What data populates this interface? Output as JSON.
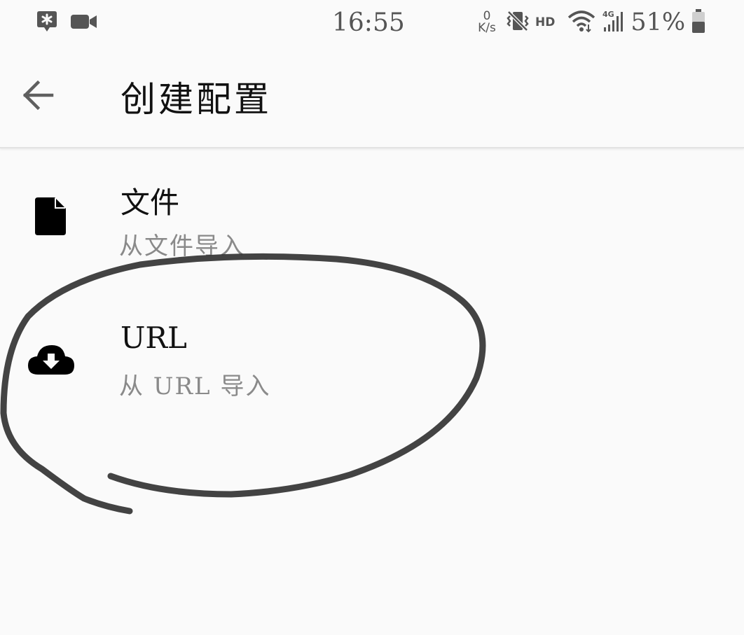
{
  "status_bar": {
    "time": "16:55",
    "net_speed_value": "0",
    "net_speed_unit": "K/s",
    "hd_label": "HD",
    "network_type": "4G",
    "battery_percent": "51%",
    "icons": [
      "chat-notification-icon",
      "video-camera-icon",
      "vibrate-icon",
      "wifi-icon",
      "signal-icon",
      "battery-icon"
    ]
  },
  "app_bar": {
    "title": "创建配置",
    "back_icon": "arrow-back-icon"
  },
  "list": {
    "items": [
      {
        "title": "文件",
        "subtitle": "从文件导入",
        "icon": "file-icon"
      },
      {
        "title": "URL",
        "subtitle": "从 URL 导入",
        "icon": "cloud-download-icon"
      }
    ]
  },
  "annotation": {
    "type": "hand-drawn circle around URL item",
    "color": "#333333"
  },
  "colors": {
    "background": "#fafafa",
    "title_text": "#111111",
    "subtitle_text": "#8a8a8a",
    "status_text": "#555555",
    "divider": "#e2e2e2"
  }
}
